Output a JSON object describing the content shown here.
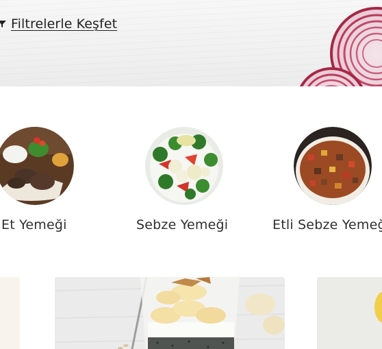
{
  "filter_link": {
    "label": "Filtrelerle Keşfet",
    "icon": "filter-funnel-icon"
  },
  "banner": {
    "decoration": "red-onion-slices"
  },
  "categories": [
    {
      "label": "Et Yemeği",
      "image": "meat-dish-photo"
    },
    {
      "label": "Sebze Yemeği",
      "image": "vegetable-dish-photo"
    },
    {
      "label": "Etli Sebze Yemeği",
      "image": "meat-vegetable-stew-photo"
    }
  ],
  "cards": [
    {
      "image": "partial-card-photo-left"
    },
    {
      "image": "banana-chia-pudding-photo"
    },
    {
      "image": "partial-card-photo-right"
    }
  ],
  "colors": {
    "text": "#2b2b2b",
    "banner_bg": "#f1f1f1",
    "onion": "#b3304f"
  }
}
